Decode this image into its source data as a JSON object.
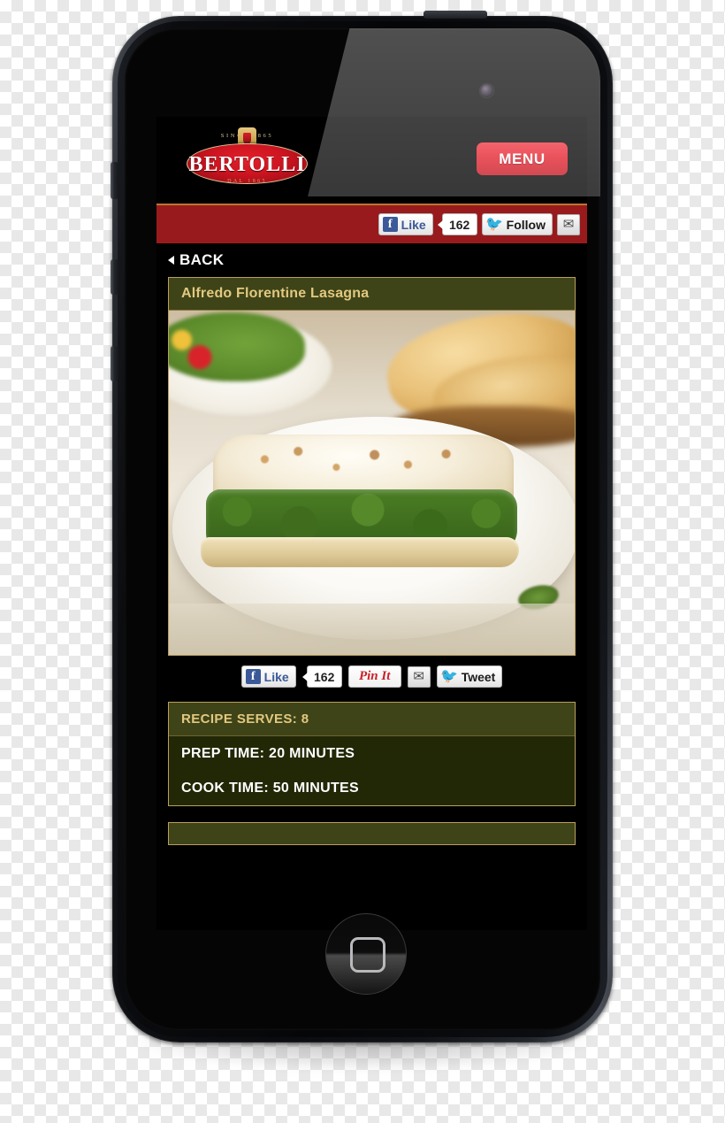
{
  "device": {
    "type": "smartphone-mockup",
    "hardware": {
      "camera": "front-camera",
      "speaker": "earpiece-speaker",
      "home_button": "home-button",
      "power_button": "power-button",
      "mute_switch": "mute-switch",
      "volume_up": "volume-up-button",
      "volume_down": "volume-down-button"
    }
  },
  "colors": {
    "brand_red": "#e31c28",
    "bar_red": "#991a1c",
    "bar_top_border": "#b9772f",
    "olive_header": "#3e4417",
    "olive_body": "#222806",
    "gold_border": "#b99f5e",
    "gold_text": "#e2c880",
    "facebook_blue": "#3b5998",
    "twitter_blue": "#32b2e8",
    "pinterest_red": "#cb2027"
  },
  "header": {
    "logo": {
      "name": "BERTOLLI",
      "since": "SINCE 1865",
      "dal": "DAL 1865",
      "crest_icon": "crest-icon"
    },
    "menu_label": "MENU"
  },
  "social_top": {
    "facebook": {
      "label": "Like",
      "icon": "facebook-icon",
      "count": "162"
    },
    "twitter": {
      "label": "Follow",
      "icon": "twitter-icon"
    },
    "email": {
      "icon": "envelope-icon",
      "glyph": "✉"
    }
  },
  "nav": {
    "back_label": "BACK",
    "back_icon": "back-triangle-icon"
  },
  "recipe": {
    "title": "Alfredo Florentine Lasagna",
    "photo_alt": "spinach-alfredo-lasagna-photo",
    "serves_label": "RECIPE SERVES: 8",
    "prep_label": "PREP TIME: 20 MINUTES",
    "cook_label": "COOK TIME: 50 MINUTES"
  },
  "social_bottom": {
    "facebook": {
      "label": "Like",
      "icon": "facebook-icon",
      "count": "162"
    },
    "pinterest": {
      "label": "Pin It",
      "icon": "pinterest-icon"
    },
    "email": {
      "icon": "envelope-icon",
      "glyph": "✉"
    },
    "twitter": {
      "label": "Tweet",
      "icon": "twitter-icon"
    }
  }
}
